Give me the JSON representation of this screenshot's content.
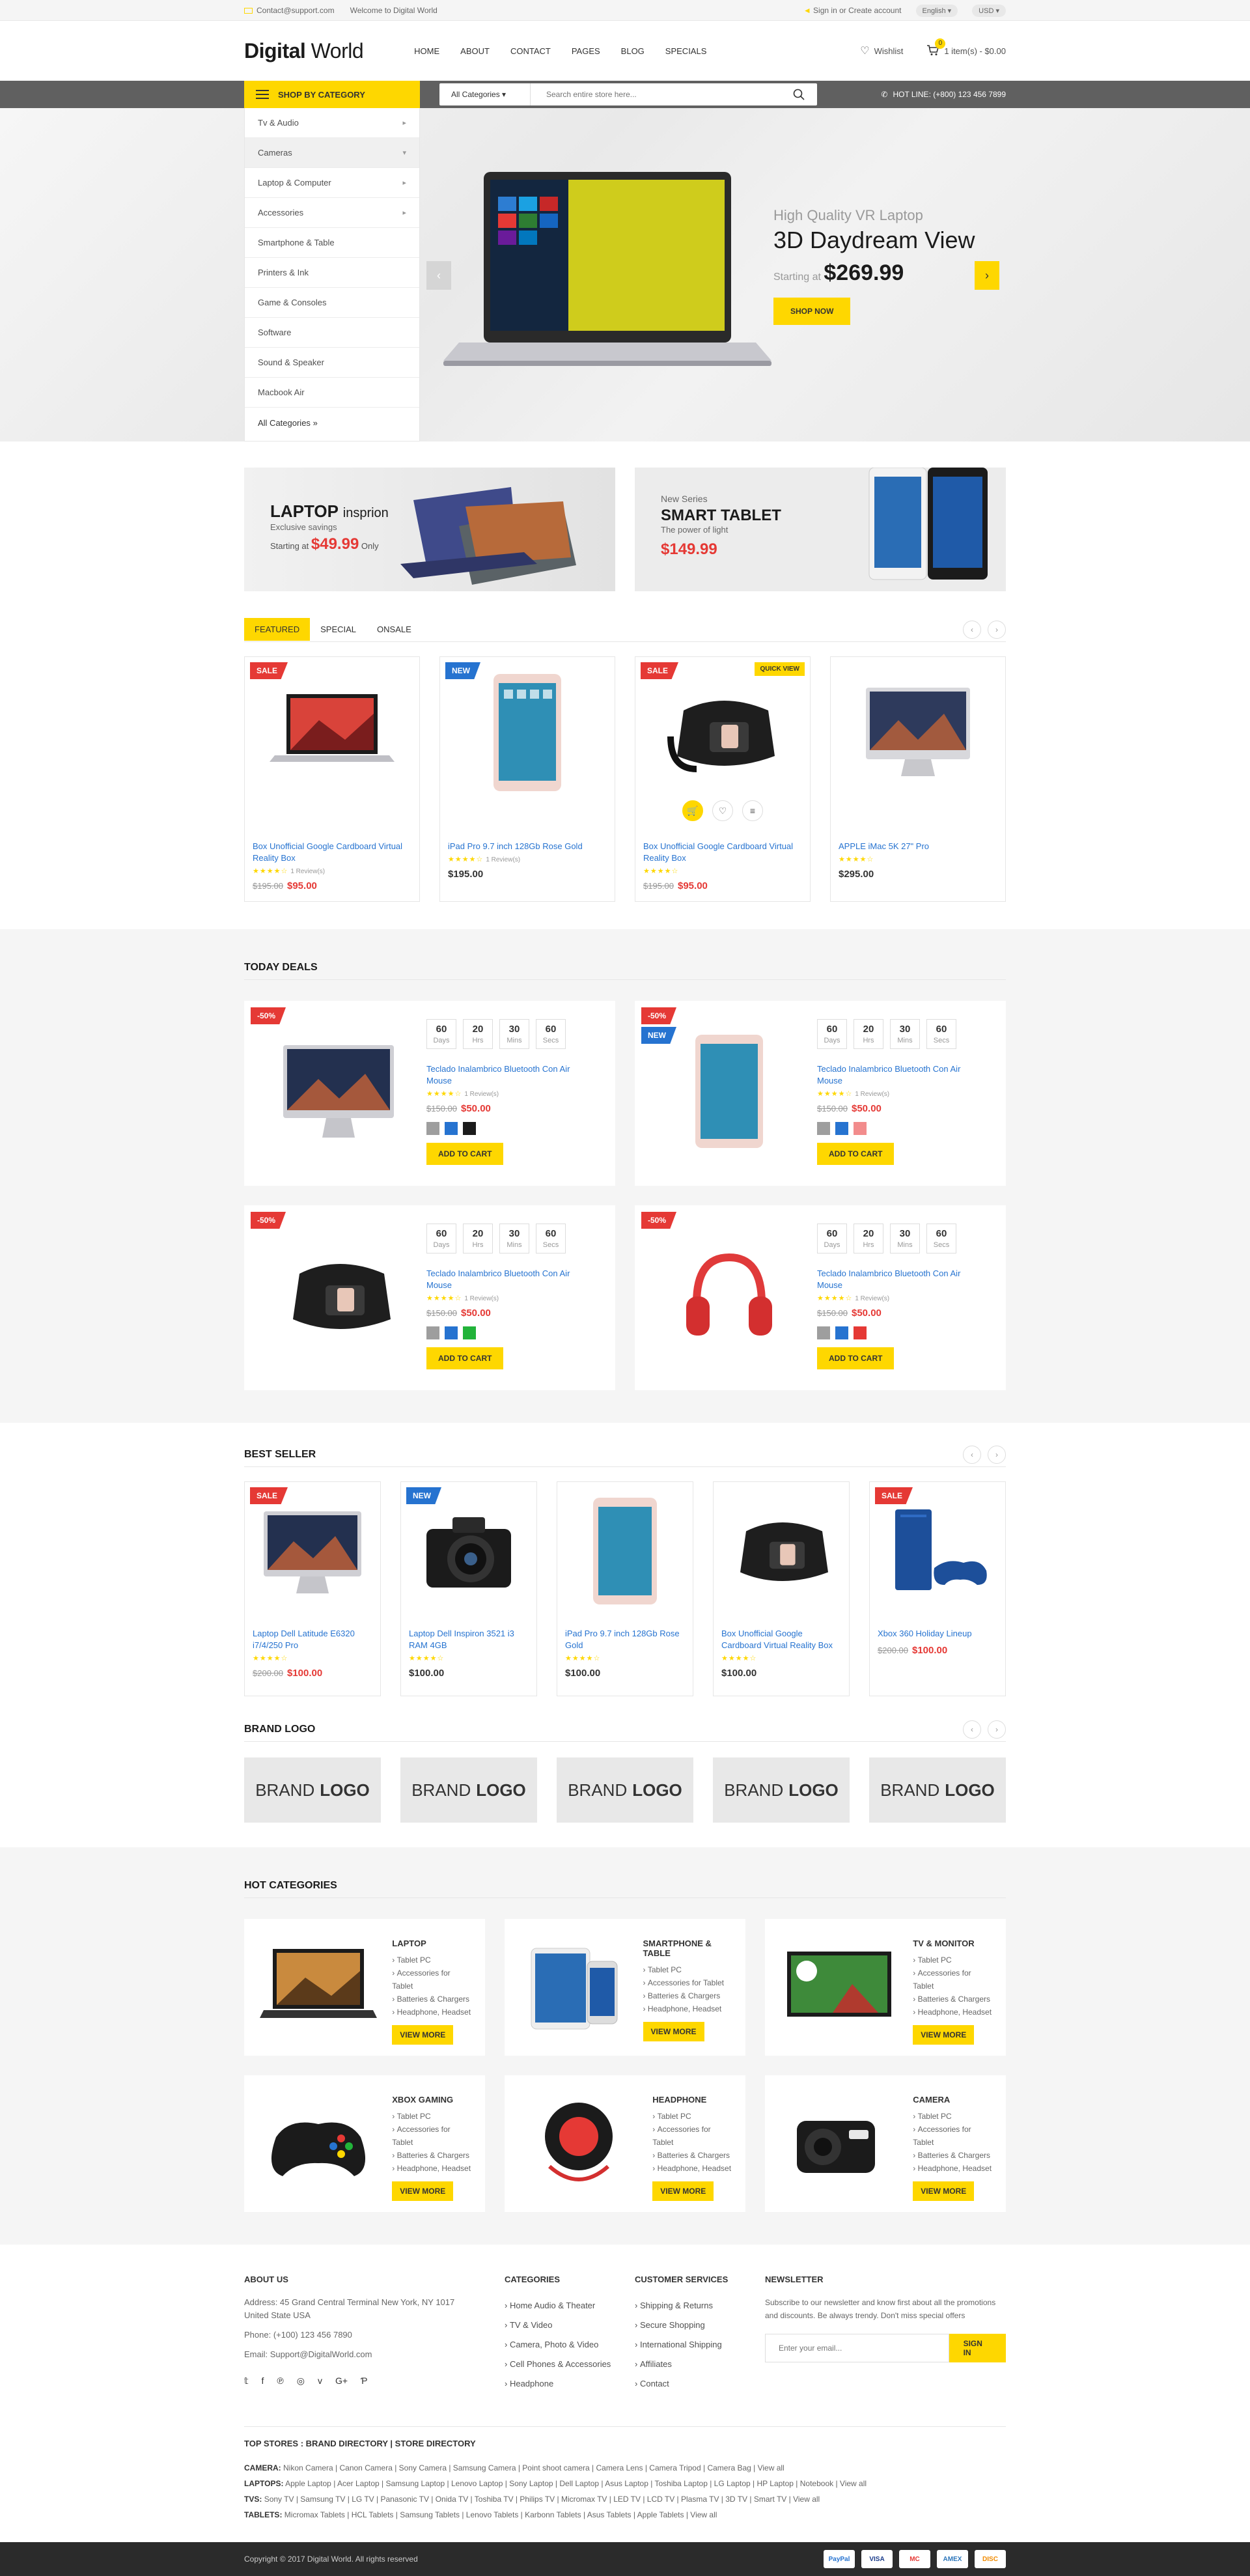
{
  "topbar": {
    "email": "Contact@support.com",
    "welcome": "Welcome to Digital World",
    "signin": "Sign in",
    "or": "or",
    "create": "Create account",
    "lang": "English",
    "currency": "USD"
  },
  "header": {
    "logo_bold": "Digital",
    "logo_light": "World",
    "nav": [
      "HOME",
      "ABOUT",
      "CONTACT",
      "PAGES",
      "BLOG",
      "SPECIALS"
    ],
    "wishlist": "Wishlist",
    "cart_count": "0",
    "cart_text": "1 item(s) - $0.00"
  },
  "navbar": {
    "shop_by": "SHOP BY CATEGORY",
    "search_cat": "All Categories",
    "search_placeholder": "Search entire store here...",
    "hotline": "HOT LINE: (+800) 123 456 7899"
  },
  "categories": [
    "Tv & Audio",
    "Cameras",
    "Laptop & Computer",
    "Accessories",
    "Smartphone & Table",
    "Printers & Ink",
    "Game & Consoles",
    "Software",
    "Sound & Speaker",
    "Macbook Air",
    "All Categories"
  ],
  "slide": {
    "sub": "High Quality VR Laptop",
    "title": "3D Daydream View",
    "starting": "Starting at",
    "price": "$269.99",
    "btn": "SHOP NOW"
  },
  "banner1": {
    "title": "LAPTOP",
    "title2": "insprion",
    "sub": "Exclusive savings",
    "starting": "Starting at",
    "price": "$49.99",
    "only": "Only"
  },
  "banner2": {
    "a": "New Series",
    "b": "SMART TABLET",
    "c": "The power of light",
    "d": "$149.99"
  },
  "tabs": [
    "FEATURED",
    "SPECIAL",
    "ONSALE"
  ],
  "featured": [
    {
      "tag": "SALE",
      "name": "Box Unofficial Google Cardboard Virtual Reality Box",
      "reviews": "1 Review(s)",
      "old": "$195.00",
      "price": "$95.00"
    },
    {
      "tag": "NEW",
      "name": "iPad Pro 9.7 inch 128Gb Rose Gold",
      "reviews": "1 Review(s)",
      "price": "$195.00"
    },
    {
      "tag": "SALE",
      "qv": "QUICK VIEW",
      "name": "Box Unofficial Google Cardboard Virtual Reality Box",
      "old": "$195.00",
      "price": "$95.00"
    },
    {
      "name": "APPLE iMac 5K 27\" Pro",
      "price": "$295.00"
    }
  ],
  "today": {
    "title": "TODAY DEALS",
    "cd_vals": [
      "60",
      "20",
      "30",
      "60"
    ],
    "cd_lbls": [
      "Days",
      "Hrs",
      "Mins",
      "Secs"
    ],
    "name": "Teclado Inalambrico Bluetooth Con Air Mouse",
    "reviews": "1 Review(s)",
    "old": "$150.00",
    "price": "$50.00",
    "off": "-50%",
    "new": "NEW",
    "btn": "ADD TO CART"
  },
  "best": {
    "title": "BEST SELLER",
    "items": [
      {
        "tag": "SALE",
        "name": "Laptop Dell Latitude E6320 i7/4/250 Pro",
        "old": "$200.00",
        "price": "$100.00"
      },
      {
        "tag": "NEW",
        "name": "Laptop Dell Inspiron 3521 i3 RAM 4GB",
        "price": "$100.00"
      },
      {
        "name": "iPad Pro 9.7 inch 128Gb Rose Gold",
        "price": "$100.00"
      },
      {
        "name": "Box Unofficial Google Cardboard Virtual Reality Box",
        "price": "$100.00"
      },
      {
        "tag": "SALE",
        "name": "Xbox 360 Holiday Lineup",
        "old": "$200.00",
        "price": "$100.00"
      }
    ]
  },
  "brand": {
    "title": "BRAND LOGO",
    "a": "BRAND",
    "b": "LOGO"
  },
  "hot": {
    "title": "HOT CATEGORIES",
    "subs": [
      "Tablet PC",
      "Accessories for Tablet",
      "Batteries & Chargers",
      "Headphone, Headset"
    ],
    "btn": "VIEW MORE",
    "cats": [
      "LAPTOP",
      "SMARTPHONE & TABLE",
      "TV & MONITOR",
      "XBOX GAMING",
      "HEADPHONE",
      "CAMERA"
    ]
  },
  "footer": {
    "about": "ABOUT US",
    "address": "Address: 45 Grand Central Terminal New York, NY 1017 United State USA",
    "phone": "Phone: (+100) 123 456 7890",
    "email": "Email: Support@DigitalWorld.com",
    "categories": "CATEGORIES",
    "cat_list": [
      "Home Audio & Theater",
      "TV & Video",
      "Camera, Photo & Video",
      "Cell Phones & Accessories",
      "Headphone"
    ],
    "services": "CUSTOMER SERVICES",
    "svc_list": [
      "Shipping & Returns",
      "Secure Shopping",
      "International Shipping",
      "Affiliates",
      "Contact"
    ],
    "newsletter": "NEWSLETTER",
    "nl_text": "Subscribe to our newsletter and know first about all the promotions and discounts. Be always trendy. Don't miss special offers",
    "nl_placeholder": "Enter your email...",
    "signin": "SIGN IN"
  },
  "stores": {
    "title": "TOP STORES : BRAND DIRECTORY | STORE DIRECTORY",
    "rows": [
      {
        "k": "CAMERA:",
        "v": "Nikon Camera | Canon Camera | Sony Camera | Samsung Camera | Point shoot camera | Camera Lens | Camera Tripod | Camera Bag | View all"
      },
      {
        "k": "LAPTOPS:",
        "v": "Apple Laptop | Acer Laptop | Samsung Laptop | Lenovo Laptop | Sony Laptop | Dell Laptop | Asus Laptop | Toshiba Laptop | LG Laptop | HP Laptop | Notebook | View all"
      },
      {
        "k": "TVS:",
        "v": "Sony TV | Samsung TV | LG TV | Panasonic TV | Onida TV | Toshiba TV | Philips TV | Micromax TV | LED TV | LCD TV | Plasma TV | 3D TV | Smart TV | View all"
      },
      {
        "k": "TABLETS:",
        "v": "Micromax Tablets | HCL Tablets | Samsung Tablets | Lenovo Tablets | Karbonn Tablets | Asus Tablets | Apple Tablets | View all"
      }
    ]
  },
  "copyright": "Copyright © 2017 Digital World. All rights reserved",
  "payments": [
    "PayPal",
    "VISA",
    "MC",
    "AMEX",
    "DISC"
  ]
}
